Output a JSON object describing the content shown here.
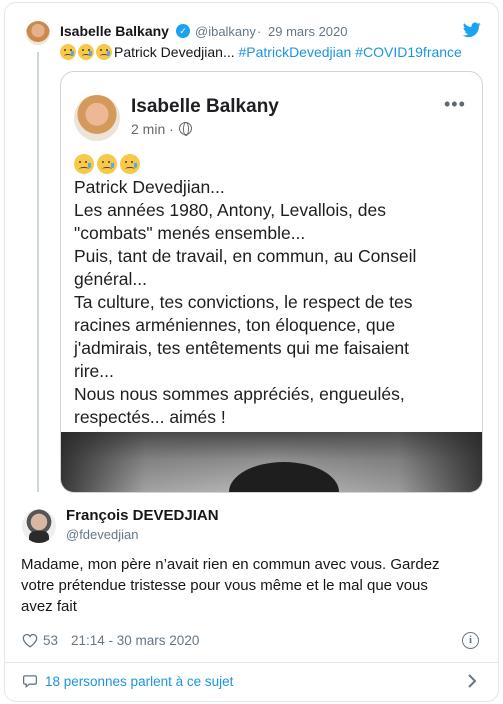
{
  "colors": {
    "link": "#1b95e0",
    "muted": "#657786",
    "verified": "#1da1f2",
    "border": "#e1e8ed"
  },
  "quoted": {
    "author_name": "Isabelle Balkany",
    "verified_icon": "verified-badge-icon",
    "handle": "@ibalkany",
    "separator": "·",
    "date": "29 mars 2020",
    "text_name": "Patrick Devedjian...",
    "hashtag_1": "#PatrickDevedjian",
    "hashtag_2": "#COVID19france",
    "emoji_icon": "sad-tear-emoji-icon"
  },
  "embedded_post": {
    "author_name": "Isabelle Balkany",
    "time": "2 min ·",
    "more_label": "•••",
    "lines": [
      "Patrick Devedjian...",
      "Les années 1980, Antony, Levallois, des",
      "\"combats\" menés ensemble...",
      "Puis, tant de travail, en commun, au Conseil",
      "général...",
      "Ta culture, tes convictions, le respect de tes",
      "racines arméniennes, ton éloquence, que",
      "j'admirais, tes entêtements qui me faisaient",
      "rire...",
      "Nous nous sommes appréciés, engueulés,",
      "respectés... aimés !"
    ]
  },
  "reply": {
    "author_name": "François DEVEDJIAN",
    "handle": "@fdevedjian",
    "lines": [
      "Madame, mon père n’avait rien en commun avec vous. Gardez",
      "votre prétendue tristesse pour vous même et le mal que vous",
      "avez fait"
    ],
    "likes": "53",
    "timestamp": "21:14 - 30 mars 2020",
    "info_label": "i"
  },
  "footer": {
    "talk_label": "18 personnes parlent à ce sujet"
  }
}
